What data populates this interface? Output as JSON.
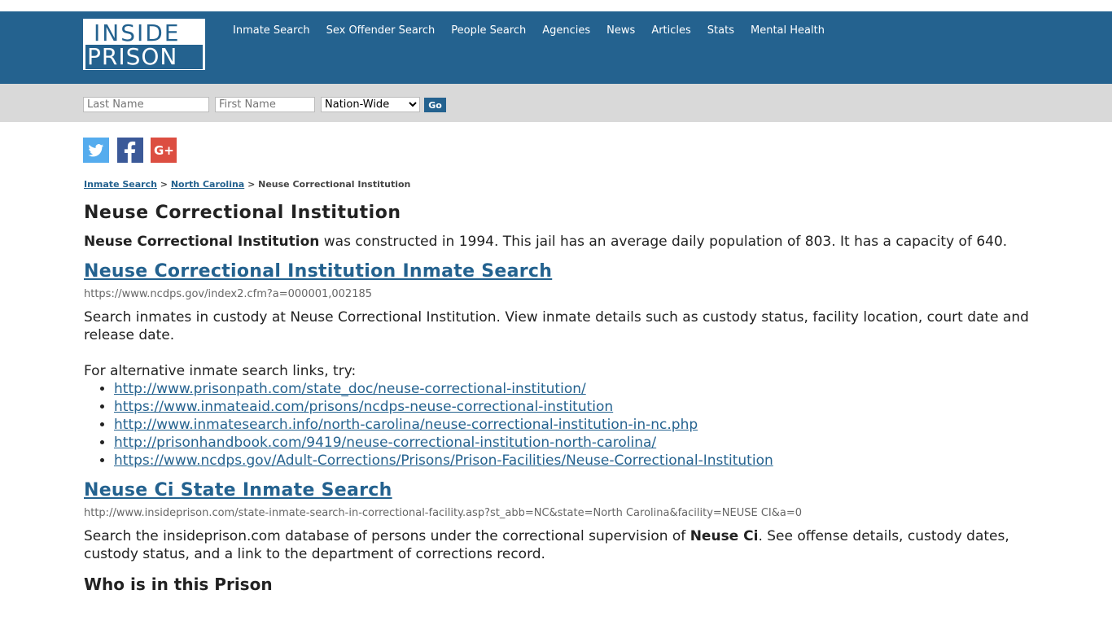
{
  "logo": {
    "line1": "INSIDE",
    "line2": "PRISON"
  },
  "nav": [
    "Inmate Search",
    "Sex Offender Search",
    "People Search",
    "Agencies",
    "News",
    "Articles",
    "Stats",
    "Mental Health"
  ],
  "search": {
    "last_placeholder": "Last Name",
    "first_placeholder": "First Name",
    "scope": "Nation-Wide",
    "go": "Go"
  },
  "breadcrumb": {
    "home": "Inmate Search",
    "sep1": " > ",
    "state": "North Carolina",
    "sep2": " > ",
    "current": "Neuse Correctional Institution"
  },
  "page": {
    "title": "Neuse Correctional Institution",
    "intro_bold": "Neuse Correctional Institution",
    "intro_rest": " was constructed in 1994. This jail has an average daily population of 803. It has a capacity of 640."
  },
  "section1": {
    "title": "Neuse Correctional Institution Inmate Search",
    "url": "https://www.ncdps.gov/index2.cfm?a=000001,002185",
    "desc": "Search inmates in custody at Neuse Correctional Institution. View inmate details such as custody status, facility location, court date and release date.",
    "alt_intro": "For alternative inmate search links, try:",
    "links": [
      "http://www.prisonpath.com/state_doc/neuse-correctional-institution/",
      "https://www.inmateaid.com/prisons/ncdps-neuse-correctional-institution",
      "http://www.inmatesearch.info/north-carolina/neuse-correctional-institution-in-nc.php",
      "http://prisonhandbook.com/9419/neuse-correctional-institution-north-carolina/",
      "https://www.ncdps.gov/Adult-Corrections/Prisons/Prison-Facilities/Neuse-Correctional-Institution"
    ]
  },
  "section2": {
    "title": "Neuse Ci State Inmate Search",
    "url": "http://www.insideprison.com/state-inmate-search-in-correctional-facility.asp?st_abb=NC&state=North Carolina&facility=NEUSE CI&a=0",
    "desc_pre": "Search the insideprison.com database of persons under the correctional supervision of ",
    "desc_bold": "Neuse Ci",
    "desc_post": ". See offense details, custody dates, custody status, and a link to the department of corrections record."
  },
  "section3": {
    "title": "Who is in this Prison"
  },
  "colors": {
    "brand": "#24628f",
    "searchbar": "#d9d9d9",
    "twitter": "#55acee",
    "facebook": "#3b5998",
    "googleplus": "#dc4e41"
  }
}
